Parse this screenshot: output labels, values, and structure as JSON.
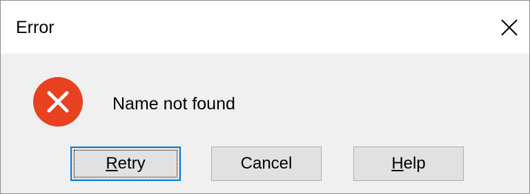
{
  "window": {
    "title": "Error",
    "close_icon": "close-icon"
  },
  "message": {
    "icon": "error-icon",
    "icon_color": "#e8411f",
    "text": "Name not found"
  },
  "buttons": {
    "retry": {
      "mnemonic": "R",
      "rest": "etry"
    },
    "cancel": {
      "label": "Cancel"
    },
    "help": {
      "mnemonic": "H",
      "rest": "elp"
    }
  },
  "colors": {
    "focus_border": "#0078d7",
    "dialog_bg": "#f0f0f0",
    "button_bg": "#e1e1e1"
  }
}
